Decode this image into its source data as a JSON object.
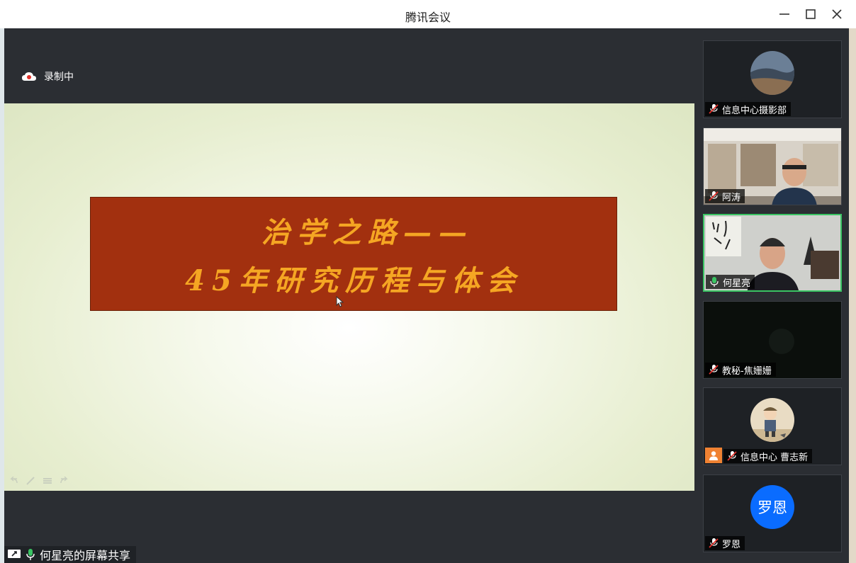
{
  "window": {
    "title": "腾讯会议"
  },
  "recording": {
    "label": "录制中"
  },
  "slide": {
    "line1": "治学之路——",
    "line2": "45年研究历程与体会",
    "banner_color": "#a2300f",
    "text_color": "#f5a623"
  },
  "share": {
    "label": "何星亮的屏幕共享"
  },
  "participants": [
    {
      "name": "信息中心摄影部",
      "muted": true,
      "view": "avatar-photo"
    },
    {
      "name": "阿涛",
      "muted": true,
      "view": "video"
    },
    {
      "name": "何星亮",
      "muted": false,
      "speaking": true,
      "view": "video"
    },
    {
      "name": "教秘-焦姗姗",
      "muted": true,
      "view": "dark"
    },
    {
      "name": "信息中心 曹志新",
      "muted": true,
      "view": "avatar-illustration"
    },
    {
      "name": "罗恩",
      "muted": true,
      "view": "avatar-initials",
      "initials": "罗恩"
    }
  ],
  "colors": {
    "accent_green": "#3ac463",
    "avatar_blue": "#0a6cff",
    "badge_orange": "#f08232"
  }
}
